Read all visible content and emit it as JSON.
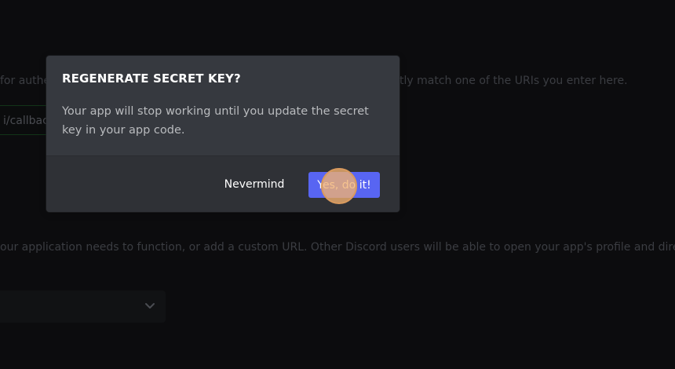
{
  "background": {
    "redirect_help_text_left": "for authen",
    "redirect_help_text_right": "tly match one of the URIs you enter here.",
    "redirect_input_value": "i/callbac",
    "install_help_text": "our application needs to function, or add a custom URL. Other Discord users will be able to open your app's profile and directly add",
    "select_icon": "chevron-down-icon"
  },
  "modal": {
    "title": "REGENERATE SECRET KEY?",
    "body": "Your app will stop working until you update the secret key in your app code.",
    "cancel_label": "Nevermind",
    "confirm_label": "Yes, do it!"
  },
  "colors": {
    "accent": "#5865f2",
    "modal_bg": "#36393f",
    "footer_bg": "#2f3136",
    "click_indicator": "#f4b270"
  }
}
